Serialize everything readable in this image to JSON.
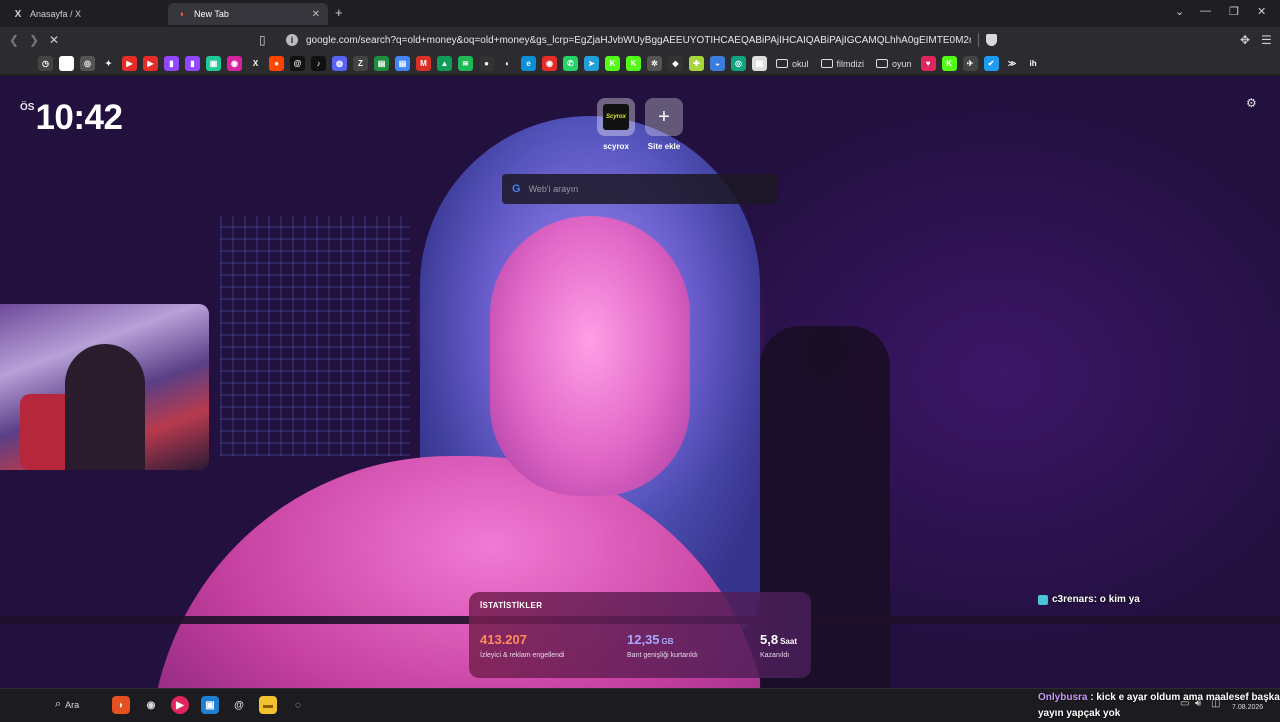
{
  "tabs": [
    {
      "title": "Anasayfa / X",
      "icon": "x-logo-icon",
      "active": false
    },
    {
      "title": "New Tab",
      "icon": "brave-logo-icon",
      "active": true
    }
  ],
  "toolbar": {
    "url": "google.com/search?q=old+money&oq=old+money&gs_lcrp=EgZjaHJvbWUyBggAEEUYOTIHCAEQABiPAjIHCAIQABiPAjIGCAMQLhhA0gEIMTE0M2owajeoAgC..."
  },
  "bookmarks": {
    "icons": [
      {
        "name": "history-icon",
        "color": "#444444",
        "glyph": "◷"
      },
      {
        "name": "google-icon",
        "color": "#ffffff",
        "glyph": "G"
      },
      {
        "name": "chatgpt-icon",
        "color": "#555555",
        "glyph": "◎"
      },
      {
        "name": "gemini-icon",
        "color": "#2b2b30",
        "glyph": "✦"
      },
      {
        "name": "youtube-icon",
        "color": "#e52d27",
        "glyph": "▶"
      },
      {
        "name": "youtube-music-icon",
        "color": "#e52d27",
        "glyph": "▶"
      },
      {
        "name": "twitch-icon",
        "color": "#9146ff",
        "glyph": "▮"
      },
      {
        "name": "twitch-alt-icon",
        "color": "#9146ff",
        "glyph": "▮"
      },
      {
        "name": "kick-tv-icon",
        "color": "#20c997",
        "glyph": "▣"
      },
      {
        "name": "instagram-icon",
        "color": "#d6249f",
        "glyph": "◉"
      },
      {
        "name": "x-icon",
        "color": "#2b2b30",
        "glyph": "X"
      },
      {
        "name": "reddit-icon",
        "color": "#ff4500",
        "glyph": "●"
      },
      {
        "name": "threads-icon",
        "color": "#111111",
        "glyph": "@"
      },
      {
        "name": "tiktok-icon",
        "color": "#111111",
        "glyph": "♪"
      },
      {
        "name": "discord-icon",
        "color": "#5865f2",
        "glyph": "◍"
      },
      {
        "name": "zed-icon",
        "color": "#444444",
        "glyph": "Z"
      },
      {
        "name": "sheets-icon",
        "color": "#1e8e3e",
        "glyph": "▤"
      },
      {
        "name": "docs-icon",
        "color": "#4285f4",
        "glyph": "▤"
      },
      {
        "name": "gmail-icon",
        "color": "#d93025",
        "glyph": "M"
      },
      {
        "name": "drive-icon",
        "color": "#0f9d58",
        "glyph": "▲"
      },
      {
        "name": "spotify-icon",
        "color": "#1db954",
        "glyph": "≋"
      },
      {
        "name": "steam-icon",
        "color": "#333333",
        "glyph": "●"
      },
      {
        "name": "github-icon",
        "color": "#2b2b30",
        "glyph": "◐"
      },
      {
        "name": "edge-icon",
        "color": "#0c8fd8",
        "glyph": "e"
      },
      {
        "name": "music-icon",
        "color": "#e52d27",
        "glyph": "◉"
      },
      {
        "name": "whatsapp-icon",
        "color": "#25d366",
        "glyph": "✆"
      },
      {
        "name": "telegram-icon",
        "color": "#229ed9",
        "glyph": "➤"
      },
      {
        "name": "kick-icon",
        "color": "#53fc18",
        "glyph": "K"
      },
      {
        "name": "kick-alt-icon",
        "color": "#53fc18",
        "glyph": "K"
      },
      {
        "name": "wheel-icon",
        "color": "#555555",
        "glyph": "✲"
      },
      {
        "name": "diamond-icon",
        "color": "#333333",
        "glyph": "◆"
      },
      {
        "name": "puzzle-icon",
        "color": "#a5d63f",
        "glyph": "✚"
      },
      {
        "name": "drop-icon",
        "color": "#3b7ddd",
        "glyph": "◒"
      },
      {
        "name": "openai-icon",
        "color": "#10a37f",
        "glyph": "◎"
      },
      {
        "name": "grid-icon",
        "color": "#dddddd",
        "glyph": "▦"
      }
    ],
    "folders": [
      "okul",
      "filmdizi",
      "oyun"
    ],
    "icons_after": [
      {
        "name": "heart-icon",
        "color": "#e0245e",
        "glyph": "♥"
      },
      {
        "name": "kick-green-icon",
        "color": "#53fc18",
        "glyph": "K"
      },
      {
        "name": "plane-icon",
        "color": "#444444",
        "glyph": "✈"
      },
      {
        "name": "check-icon",
        "color": "#1d9bf0",
        "glyph": "✔"
      },
      {
        "name": "more-icon",
        "color": "#2b2b30",
        "glyph": "≫"
      },
      {
        "name": "ih-icon",
        "color": "#2b2b30",
        "glyph": "ih"
      }
    ]
  },
  "clock": {
    "ampm": "ÖS",
    "time": "10:42"
  },
  "top_sites": [
    {
      "label": "scyrox",
      "logo_text": "Scyrox"
    },
    {
      "label": "Site ekle"
    }
  ],
  "search": {
    "placeholder": "Web'i arayın",
    "engine_icon": "google-icon"
  },
  "stats": {
    "title": "İSTATİSTİKLER",
    "items": [
      {
        "value": "413.207",
        "unit": "",
        "label": "İzleyici & reklam engellendi",
        "color": "#ff8a5c"
      },
      {
        "value": "12,35",
        "unit": "GB",
        "label": "Bant genişliği kurtarıldı",
        "color": "#a8a7ff"
      },
      {
        "value": "5,8",
        "unit": "Saat",
        "label": "Kazanıldı",
        "color": "#ffffff"
      }
    ]
  },
  "chat": [
    {
      "user": "c3renars",
      "message": " : o kim ya"
    },
    {
      "user": "Onlybusra",
      "message": " : kick e ayar oldum ama maalesef başka yayın yapçak yok"
    }
  ],
  "taskbar": {
    "search_label": "Ara",
    "date": "7.08.2026"
  }
}
